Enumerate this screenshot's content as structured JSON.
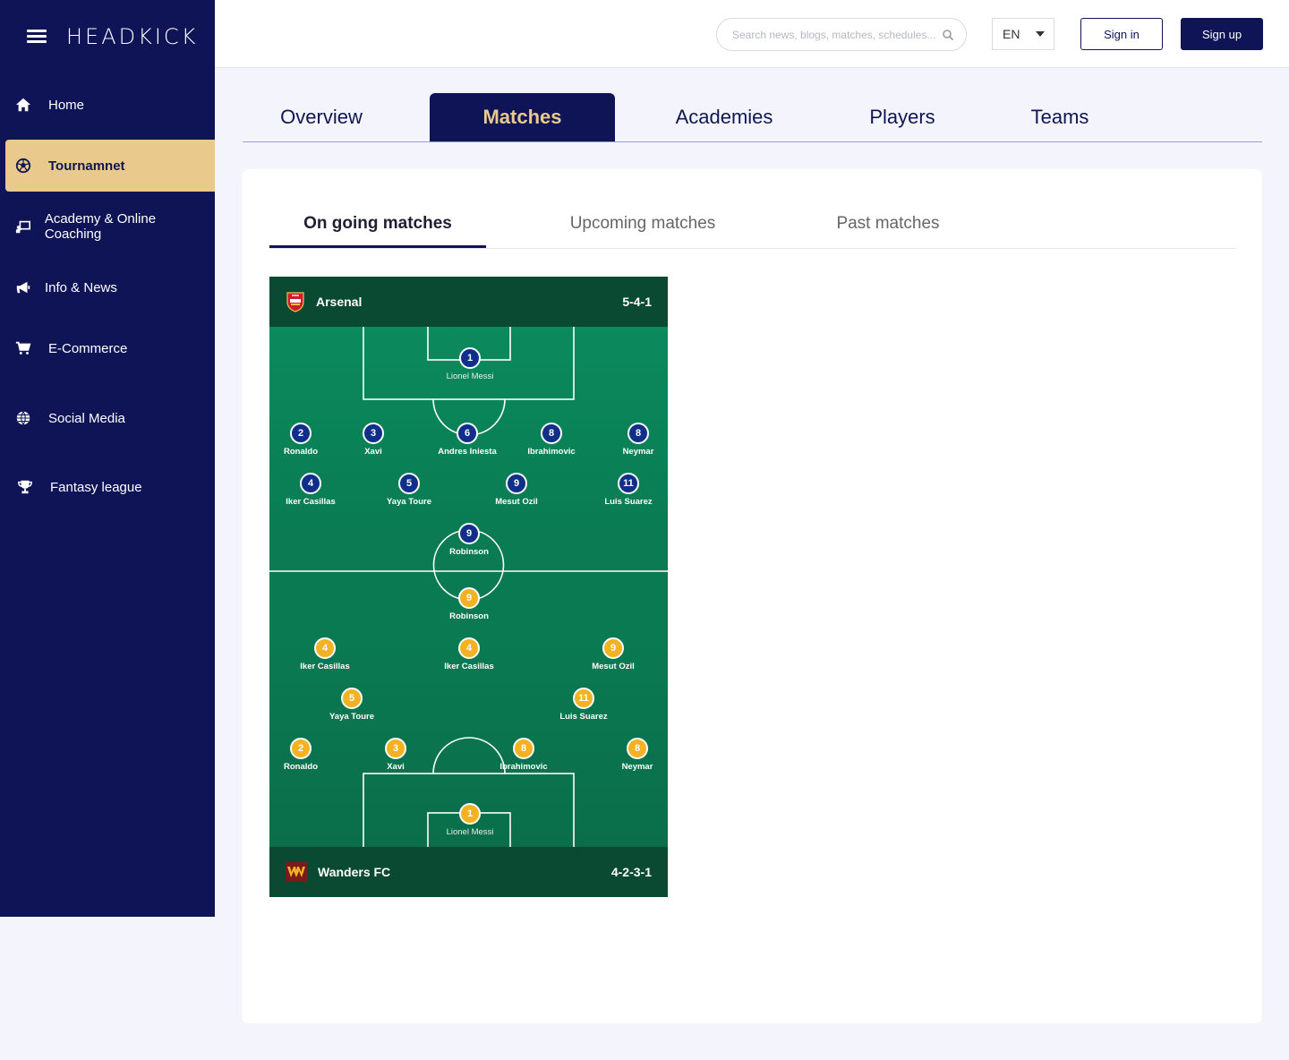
{
  "brand": {
    "title": "HEADKICK"
  },
  "sidebar": {
    "items": [
      {
        "label": "Home",
        "icon": "home-icon"
      },
      {
        "label": "Tournamnet",
        "icon": "soccer-ball-icon",
        "active": true
      },
      {
        "label": "Academy & Online Coaching",
        "icon": "online-coaching-icon"
      },
      {
        "label": "Info & News",
        "icon": "megaphone-icon"
      },
      {
        "label": "E-Commerce",
        "icon": "cart-icon"
      },
      {
        "label": "Social Media",
        "icon": "globe-icon"
      },
      {
        "label": "Fantasy league",
        "icon": "trophy-icon"
      }
    ]
  },
  "header": {
    "search_placeholder": "Search news, blogs, matches, schedules...",
    "language": "EN",
    "signin_label": "Sign in",
    "signup_label": "Sign up"
  },
  "main_tabs": [
    {
      "label": "Overview"
    },
    {
      "label": "Matches",
      "active": true
    },
    {
      "label": "Academies"
    },
    {
      "label": "Players"
    },
    {
      "label": "Teams"
    }
  ],
  "sub_tabs": [
    {
      "label": "On going matches",
      "active": true
    },
    {
      "label": "Upcoming matches"
    },
    {
      "label": "Past matches"
    }
  ],
  "match": {
    "home": {
      "name": "Arsenal",
      "formation": "5-4-1"
    },
    "away": {
      "name": "Wanders FC",
      "formation": "4-2-3-1"
    },
    "home_players": [
      {
        "num": "1",
        "name": "Lionel Messi"
      },
      {
        "num": "2",
        "name": "Ronaldo"
      },
      {
        "num": "3",
        "name": "Xavi"
      },
      {
        "num": "6",
        "name": "Andres Iniesta"
      },
      {
        "num": "8",
        "name": "Ibrahimovic"
      },
      {
        "num": "8",
        "name": "Neymar"
      },
      {
        "num": "4",
        "name": "Iker Casillas"
      },
      {
        "num": "5",
        "name": "Yaya Toure"
      },
      {
        "num": "9",
        "name": "Mesut Ozil"
      },
      {
        "num": "11",
        "name": "Luis Suarez"
      },
      {
        "num": "9",
        "name": "Robinson"
      }
    ],
    "away_players": [
      {
        "num": "9",
        "name": "Robinson"
      },
      {
        "num": "4",
        "name": "Iker Casillas"
      },
      {
        "num": "4",
        "name": "Iker Casillas"
      },
      {
        "num": "9",
        "name": "Mesut Ozil"
      },
      {
        "num": "5",
        "name": "Yaya Toure"
      },
      {
        "num": "11",
        "name": "Luis Suarez"
      },
      {
        "num": "2",
        "name": "Ronaldo"
      },
      {
        "num": "3",
        "name": "Xavi"
      },
      {
        "num": "8",
        "name": "Ibrahimovic"
      },
      {
        "num": "8",
        "name": "Neymar"
      },
      {
        "num": "1",
        "name": "Lionel Messi"
      }
    ]
  },
  "colors": {
    "navy": "#0e1456",
    "gold": "#e9c98c",
    "pitch": "#0a7a52",
    "home_kit": "#0f2f8a",
    "away_kit": "#f2b224"
  }
}
